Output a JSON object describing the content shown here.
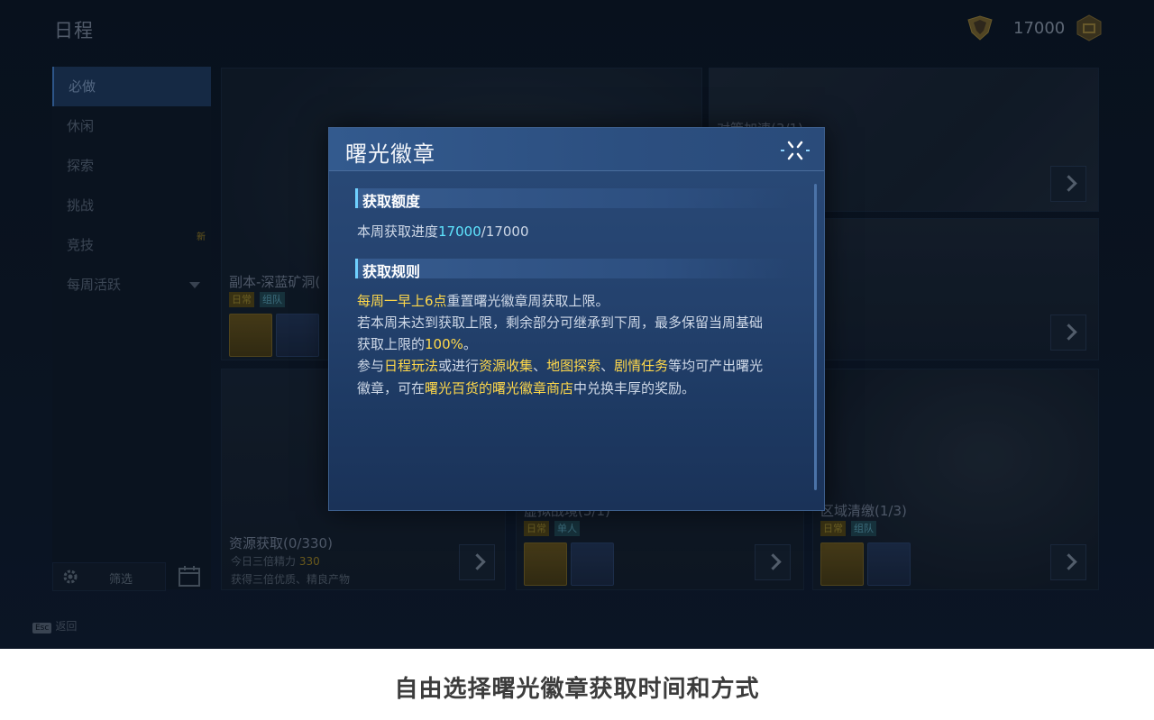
{
  "header": {
    "title": "日程",
    "currency_value": "17000"
  },
  "sidebar": {
    "items": [
      {
        "label": "必做"
      },
      {
        "label": "休闲"
      },
      {
        "label": "探索"
      },
      {
        "label": "挑战"
      },
      {
        "label": "竞技",
        "badge": "新"
      },
      {
        "label": "每周活跃"
      }
    ],
    "filter_label": "筛选"
  },
  "cards": {
    "deep_cave": {
      "title": "副本-深蓝矿洞(",
      "tag1": "日常",
      "tag2": "组队"
    },
    "resource": {
      "title": "资源获取(0/330)",
      "line1": "今日三倍精力",
      "line1_value": "330",
      "line2": "获得三倍优质、精良产物"
    },
    "top_right": {
      "title": "对策加速(3/1)"
    },
    "virtual": {
      "title": "虚拟战境(3/1)",
      "tag1": "日常",
      "tag2": "单人"
    },
    "region": {
      "title": "区域清缴(1/3)",
      "tag1": "日常",
      "tag2": "组队"
    }
  },
  "footer": {
    "esc_key": "Esc",
    "back_label": "返回"
  },
  "modal": {
    "title": "曙光徽章",
    "section1_title": "获取额度",
    "progress_prefix": "本周获取进度",
    "progress_current": "17000",
    "progress_total": "/17000",
    "section2_title": "获取规则",
    "rule1_hl": "每周一早上6点",
    "rule1_rest": "重置曙光徽章周获取上限。",
    "rule2_line1": "若本周未达到获取上限，剩余部分可继承到下周，最多保留当周基础",
    "rule2_line2_prefix": "获取上限的",
    "rule2_pct": "100%",
    "rule2_end": "。",
    "rule3_a": "参与",
    "rule3_b": "日程玩法",
    "rule3_c": "或进行",
    "rule3_d": "资源收集",
    "rule3_e": "、",
    "rule3_f": "地图探索",
    "rule3_g": "、",
    "rule3_h": "剧情任务",
    "rule3_i": "等均可产出曙光",
    "rule4_a": "徽章，可在",
    "rule4_b": "曙光百货的曙光徽章商店",
    "rule4_c": "中兑换丰厚的奖励。"
  },
  "caption": "自由选择曙光徽章获取时间和方式"
}
